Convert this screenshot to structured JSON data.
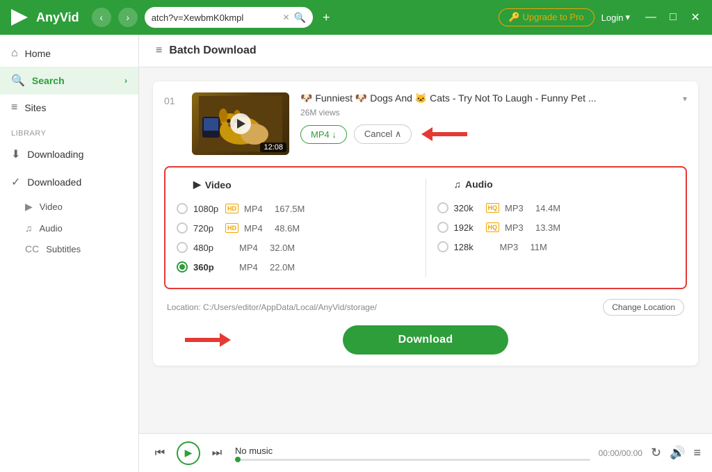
{
  "app": {
    "name": "AnyVid",
    "logo_text": "AnyVid"
  },
  "titlebar": {
    "url": "atch?v=XewbmK0kmpl",
    "upgrade_label": "🔑 Upgrade to Pro",
    "login_label": "Login"
  },
  "sidebar": {
    "items": [
      {
        "label": "Home",
        "icon": "⌂",
        "active": false
      },
      {
        "label": "Search",
        "icon": "🔍",
        "active": true
      },
      {
        "label": "Sites",
        "icon": "≡",
        "active": false
      }
    ],
    "library_label": "Library",
    "library_items": [
      {
        "label": "Downloading",
        "icon": "⬇"
      },
      {
        "label": "Downloaded",
        "icon": "✓"
      }
    ],
    "sub_items": [
      {
        "label": "Video",
        "icon": "▶"
      },
      {
        "label": "Audio",
        "icon": "♫"
      },
      {
        "label": "Subtitles",
        "icon": "CC"
      }
    ]
  },
  "page": {
    "header_icon": "≡",
    "title": "Batch Download"
  },
  "video": {
    "number": "01",
    "duration": "12:08",
    "title": "🐶 Funniest 🐶 Dogs And 🐱 Cats - Try Not To Laugh - Funny Pet ...",
    "views": "26M views",
    "format_btn": "MP4 ↓",
    "cancel_btn": "Cancel ∧"
  },
  "format_grid": {
    "video_header": "Video",
    "audio_header": "Audio",
    "video_options": [
      {
        "resolution": "1080p",
        "badge": "HD",
        "format": "MP4",
        "size": "167.5M",
        "selected": false
      },
      {
        "resolution": "720p",
        "badge": "HD",
        "format": "MP4",
        "size": "48.6M",
        "selected": false
      },
      {
        "resolution": "480p",
        "badge": "",
        "format": "MP4",
        "size": "32.0M",
        "selected": false
      },
      {
        "resolution": "360p",
        "badge": "",
        "format": "MP4",
        "size": "22.0M",
        "selected": true
      }
    ],
    "audio_options": [
      {
        "resolution": "320k",
        "badge": "HQ",
        "format": "MP3",
        "size": "14.4M",
        "selected": false
      },
      {
        "resolution": "192k",
        "badge": "HQ",
        "format": "MP3",
        "size": "13.3M",
        "selected": false
      },
      {
        "resolution": "128k",
        "badge": "",
        "format": "MP3",
        "size": "11M",
        "selected": false
      }
    ]
  },
  "location": {
    "label": "Location:",
    "path": "C:/Users/editor/AppData/Local/AnyVid/storage/",
    "change_btn": "Change Location"
  },
  "download": {
    "btn_label": "Download"
  },
  "player": {
    "title": "No music",
    "time": "00:00/00:00"
  }
}
